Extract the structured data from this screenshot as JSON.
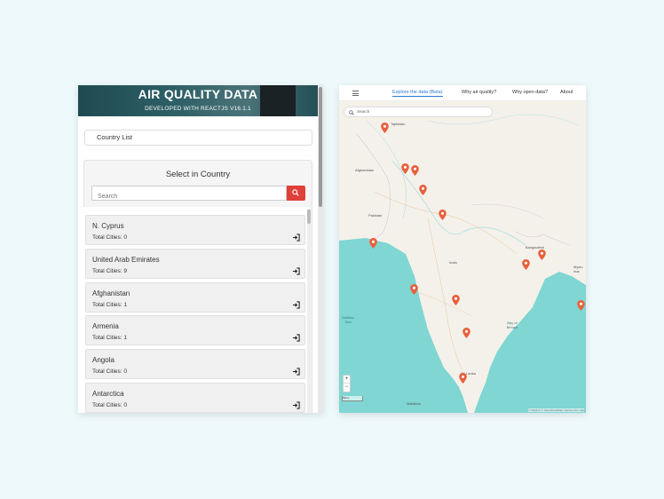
{
  "app": {
    "title": "AIR QUALITY DATA",
    "subtitle": "DEVELOPED WITH REACTJS V16.1.1"
  },
  "country_list_label": "Country List",
  "select": {
    "title": "Select in Country",
    "search_placeholder": "Search"
  },
  "countries": [
    {
      "name": "N. Cyprus",
      "cities": "Total Cities: 0"
    },
    {
      "name": "United Arab Emirates",
      "cities": "Total Cities: 9"
    },
    {
      "name": "Afghanistan",
      "cities": "Total Cities: 1"
    },
    {
      "name": "Armenia",
      "cities": "Total Cities: 1"
    },
    {
      "name": "Angola",
      "cities": "Total Cities: 0"
    },
    {
      "name": "Antarctica",
      "cities": "Total Cities: 0"
    }
  ],
  "map": {
    "nav": {
      "explore": "Explore the data (Beta)",
      "why_air": "Why air quality?",
      "why_open": "Why open data?",
      "about": "About"
    },
    "search_placeholder": "Search",
    "zoom_in": "+",
    "zoom_out": "−",
    "labels": {
      "tajikistan": "Tajikistan",
      "afghanistan": "Afghanistan",
      "pakistan": "Pakistan",
      "india": "India",
      "bangladesh": "Bangladesh",
      "myanmar": "Myan-mar",
      "sri_lanka": "Sri Lanka",
      "maldives": "Maldives",
      "arabian_sea": "Arabian Sea",
      "bay_of_bengal": "Bay of Bengal"
    },
    "scale": "50km",
    "credit": "© Mapbox © OpenStreetMap Improve this map"
  },
  "colors": {
    "accent_red": "#e0403a",
    "marker": "#e8603c",
    "water": "#7fd6d3",
    "land": "#f4f1ea",
    "nav_active": "#2a7bd5"
  }
}
